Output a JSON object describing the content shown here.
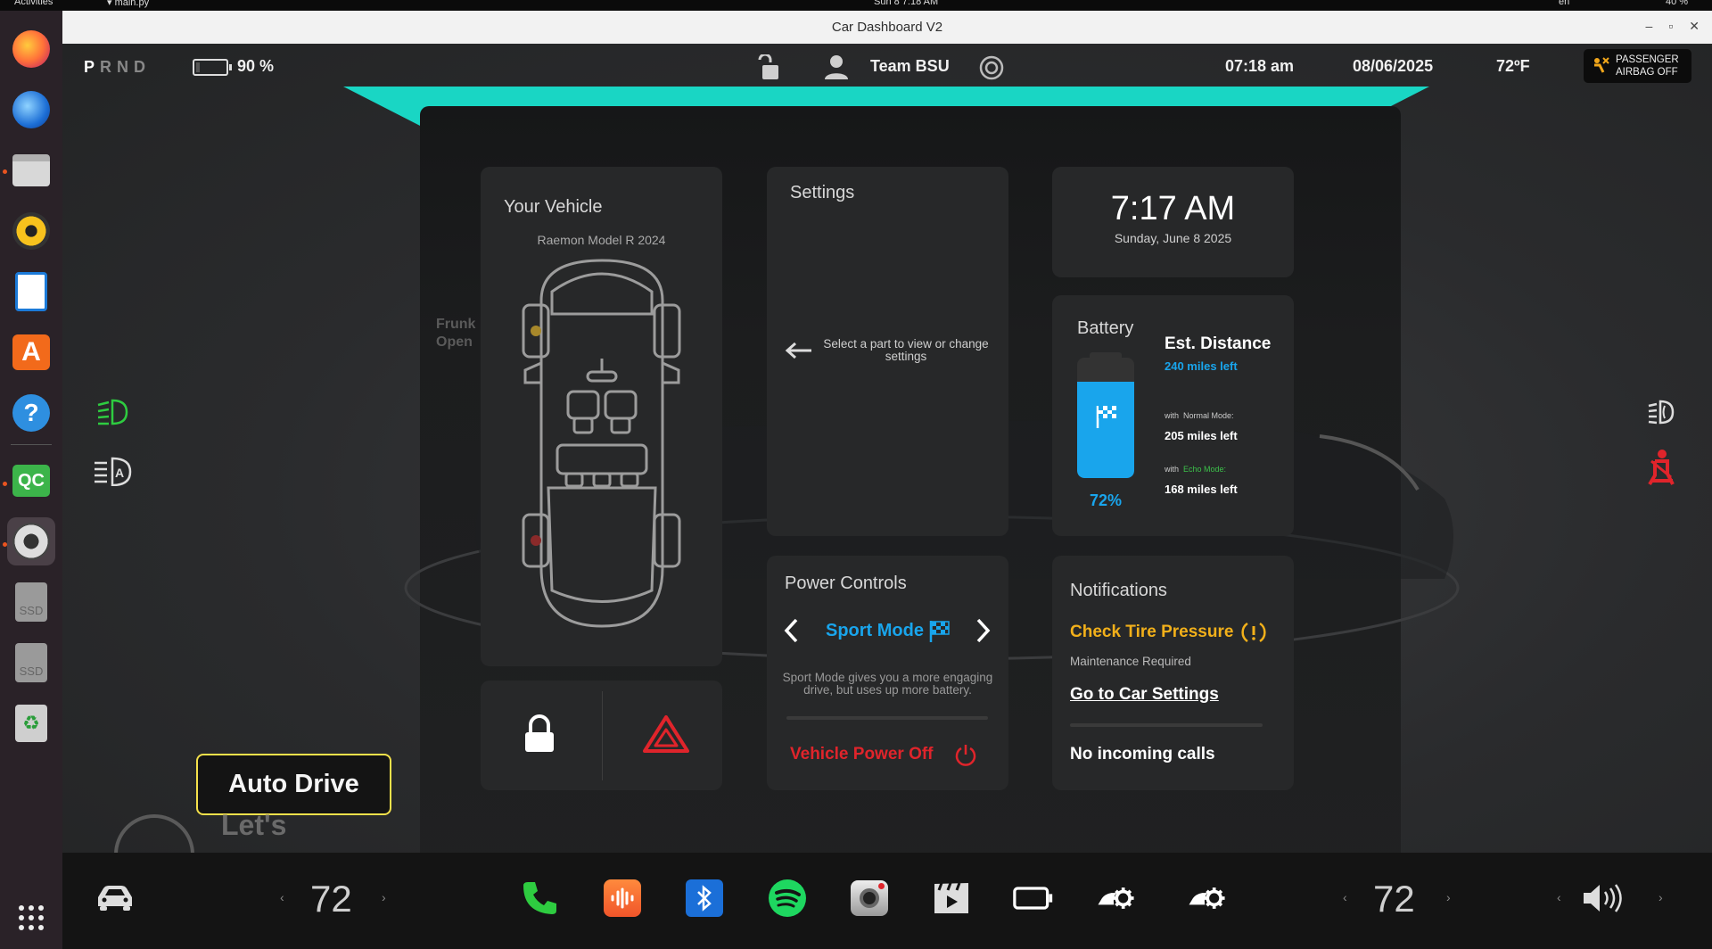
{
  "gnome": {
    "activities": "Activities",
    "app": "main.py",
    "clock": "Sun 8 7:18 AM",
    "lang": "en",
    "battery": "40 %"
  },
  "window": {
    "title": "Car Dashboard V2"
  },
  "status": {
    "gears": [
      "P",
      "R",
      "N",
      "D"
    ],
    "battery_pct": "90 %",
    "battery_level": 0.9,
    "driver": "Team BSU",
    "time": "07:18 am",
    "date": "08/06/2025",
    "temp": "72ºF",
    "airbag_line1": "PASSENGER",
    "airbag_line2": "AIRBAG OFF"
  },
  "vehicle": {
    "title": "Your Vehicle",
    "model": "Raemon Model R 2024",
    "frunk_label": "Frunk",
    "frunk_state": "Open"
  },
  "settings": {
    "title": "Settings",
    "hint": "Select a part to view or change settings"
  },
  "clock": {
    "time": "7:17 AM",
    "date": "Sunday, June 8 2025"
  },
  "battery": {
    "title": "Battery",
    "percent": "72%",
    "level": 0.72,
    "est_title": "Est. Distance",
    "est_value": "240 miles left",
    "normal_prefix": "with",
    "normal_mode": "Normal Mode:",
    "normal_value": "205 miles left",
    "echo_prefix": "with",
    "echo_mode": "Echo Mode:",
    "echo_value": "168 miles left",
    "color": "#19a5ec"
  },
  "power": {
    "title": "Power Controls",
    "mode": "Sport Mode",
    "mode_desc": "Sport Mode gives you a more engaging drive, but uses up more battery.",
    "power_off": "Vehicle Power Off"
  },
  "notifications": {
    "title": "Notifications",
    "alert": "Check Tire Pressure",
    "alert_sub": "Maintenance Required",
    "link": "Go to Car Settings",
    "calls": "No incoming calls",
    "alert_color": "#f2b01a"
  },
  "auto_drive": {
    "label": "Auto Drive",
    "lets": "Let's"
  },
  "bottom": {
    "temp_left": "72",
    "temp_right": "72"
  },
  "colors": {
    "accent_teal": "#19d6c4",
    "danger_red": "#e0242b",
    "link_blue": "#19a5ec",
    "green": "#2ecc40"
  }
}
